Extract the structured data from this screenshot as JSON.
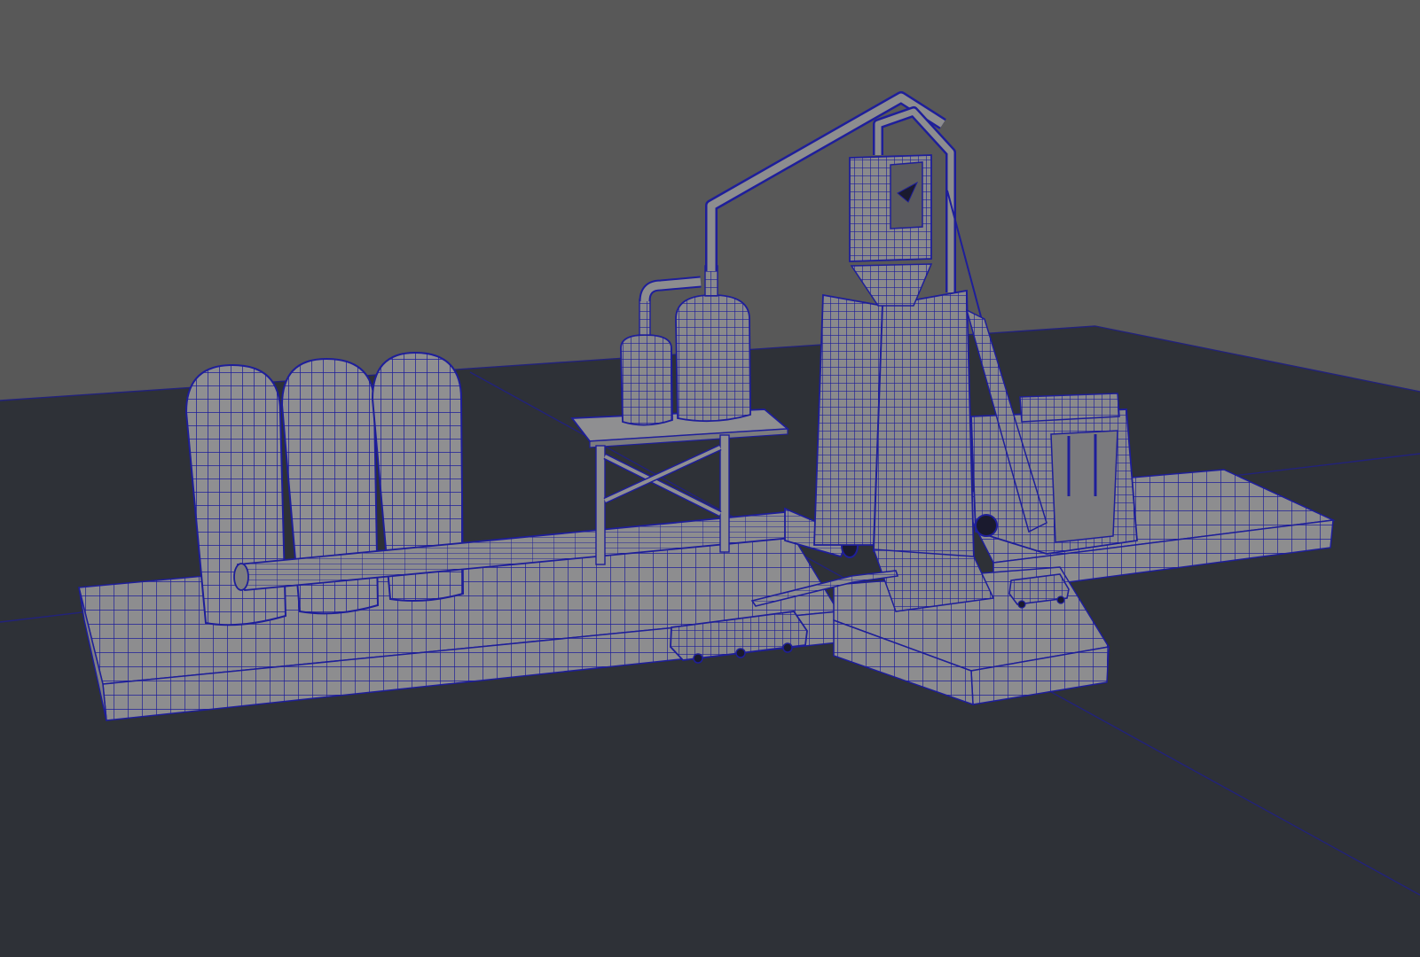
{
  "viewport": {
    "background_color": "#585858",
    "ground_color": "#2e3137",
    "grid_line_color": "#23237a",
    "mesh_fill_color": "#8b8b8b",
    "wireframe_color": "#1e1e9a",
    "shading": "wireframe-on-shaded"
  },
  "scene": {
    "objects": [
      "silo-left",
      "silo-middle",
      "silo-right",
      "horizontal-pipe",
      "distillation-table",
      "small-tank",
      "large-tank",
      "overhead-pipe",
      "boiler-tower",
      "conveyor-machine",
      "mine-cart-front",
      "mine-cart-right",
      "rail-track",
      "base-platform-left",
      "base-platform-front",
      "base-platform-right"
    ]
  }
}
